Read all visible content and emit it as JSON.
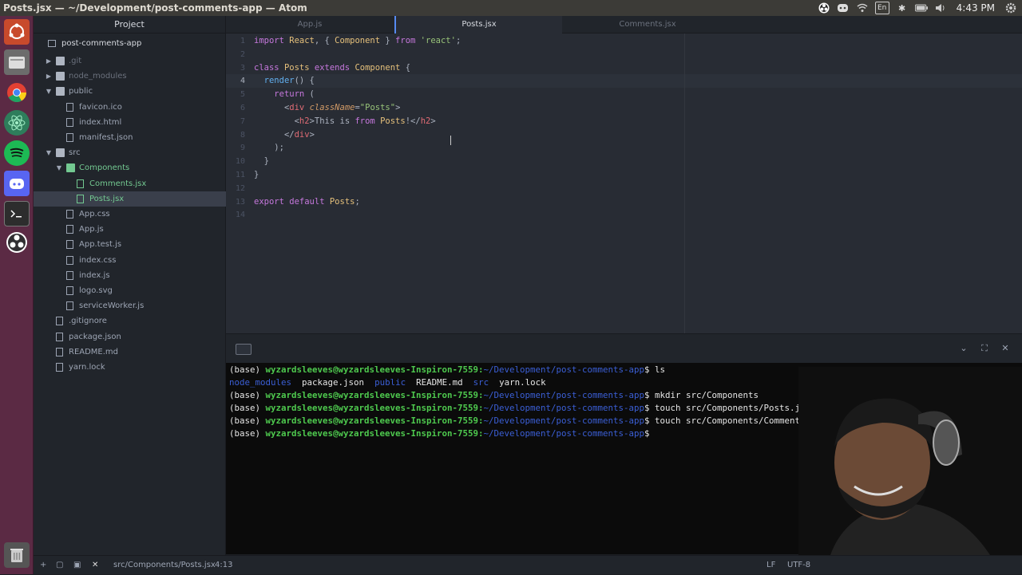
{
  "window": {
    "title": "Posts.jsx — ~/Development/post-comments-app — Atom"
  },
  "tray": {
    "keyboard_layout": "En",
    "clock": "4:43 PM"
  },
  "tree": {
    "header": "Project",
    "root": "post-comments-app",
    "items": [
      {
        "label": ".git",
        "depth": 1,
        "type": "folder",
        "expanded": false,
        "style": "dim"
      },
      {
        "label": "node_modules",
        "depth": 1,
        "type": "folder",
        "expanded": false,
        "style": "dim"
      },
      {
        "label": "public",
        "depth": 1,
        "type": "folder",
        "expanded": true,
        "style": "normal"
      },
      {
        "label": "favicon.ico",
        "depth": 2,
        "type": "file",
        "style": "normal"
      },
      {
        "label": "index.html",
        "depth": 2,
        "type": "file",
        "style": "normal"
      },
      {
        "label": "manifest.json",
        "depth": 2,
        "type": "file",
        "style": "normal"
      },
      {
        "label": "src",
        "depth": 1,
        "type": "folder",
        "expanded": true,
        "style": "normal"
      },
      {
        "label": "Components",
        "depth": 2,
        "type": "folder",
        "expanded": true,
        "style": "green"
      },
      {
        "label": "Comments.jsx",
        "depth": 3,
        "type": "file",
        "style": "green"
      },
      {
        "label": "Posts.jsx",
        "depth": 3,
        "type": "file",
        "style": "green",
        "selected": true
      },
      {
        "label": "App.css",
        "depth": 2,
        "type": "file",
        "style": "normal"
      },
      {
        "label": "App.js",
        "depth": 2,
        "type": "file",
        "style": "normal"
      },
      {
        "label": "App.test.js",
        "depth": 2,
        "type": "file",
        "style": "normal"
      },
      {
        "label": "index.css",
        "depth": 2,
        "type": "file",
        "style": "normal"
      },
      {
        "label": "index.js",
        "depth": 2,
        "type": "file",
        "style": "normal"
      },
      {
        "label": "logo.svg",
        "depth": 2,
        "type": "file",
        "style": "normal"
      },
      {
        "label": "serviceWorker.js",
        "depth": 2,
        "type": "file",
        "style": "normal"
      },
      {
        "label": ".gitignore",
        "depth": 1,
        "type": "file",
        "style": "normal"
      },
      {
        "label": "package.json",
        "depth": 1,
        "type": "file",
        "style": "normal"
      },
      {
        "label": "README.md",
        "depth": 1,
        "type": "file",
        "style": "normal"
      },
      {
        "label": "yarn.lock",
        "depth": 1,
        "type": "file",
        "style": "normal"
      }
    ]
  },
  "tabs": [
    {
      "label": "App.js",
      "active": false
    },
    {
      "label": "Posts.jsx",
      "active": true
    },
    {
      "label": "Comments.jsx",
      "active": false
    }
  ],
  "editor": {
    "current_line": 4,
    "lines": [
      {
        "n": "1",
        "text": "import React, { Component } from 'react';"
      },
      {
        "n": "2",
        "text": ""
      },
      {
        "n": "3",
        "text": "class Posts extends Component {"
      },
      {
        "n": "4",
        "text": "  render() {"
      },
      {
        "n": "5",
        "text": "    return ("
      },
      {
        "n": "6",
        "text": "      <div className=\"Posts\">"
      },
      {
        "n": "7",
        "text": "        <h2>This is from Posts!</h2>"
      },
      {
        "n": "8",
        "text": "      </div>"
      },
      {
        "n": "9",
        "text": "    );"
      },
      {
        "n": "10",
        "text": "  }"
      },
      {
        "n": "11",
        "text": "}"
      },
      {
        "n": "12",
        "text": ""
      },
      {
        "n": "13",
        "text": "export default Posts;"
      },
      {
        "n": "14",
        "text": ""
      }
    ]
  },
  "terminal": {
    "prompt_prefix": "(base) ",
    "user_host": "wyzardsleeves@wyzardsleeves-Inspiron-7559:",
    "path": "~/Development/post-comments-app",
    "lines": [
      {
        "type": "prompt",
        "cmd": "$ ls"
      },
      {
        "type": "listing",
        "items": [
          {
            "text": "node_modules",
            "dir": true
          },
          {
            "text": "package.json",
            "dir": false
          },
          {
            "text": "public",
            "dir": true
          },
          {
            "text": "README.md",
            "dir": false
          },
          {
            "text": "src",
            "dir": true
          },
          {
            "text": "yarn.lock",
            "dir": false
          }
        ]
      },
      {
        "type": "prompt",
        "cmd": "$ mkdir src/Components"
      },
      {
        "type": "prompt",
        "cmd": "$ touch src/Components/Posts.js"
      },
      {
        "type": "prompt",
        "cmd": "$ touch src/Components/Comment"
      },
      {
        "type": "prompt",
        "cmd": "$"
      }
    ]
  },
  "status": {
    "file_path": "src/Components/Posts.jsx",
    "cursor": "4:13",
    "line_ending": "LF",
    "encoding": "UTF-8"
  },
  "colors": {
    "launcher_bg": "#5b2a44",
    "editor_bg": "#282c34",
    "accent": "#568af2"
  }
}
